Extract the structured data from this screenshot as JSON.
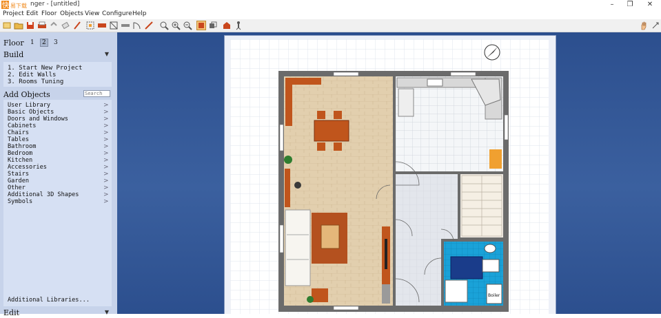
{
  "window": {
    "logo_text": "快",
    "logo_sub": "易下载",
    "title": "nger - [untitled]",
    "minimize_glyph": "–",
    "maximize_glyph": "❐",
    "close_glyph": "✕"
  },
  "menu": [
    "Project",
    "Edit",
    "Floor",
    "Objects",
    "View",
    "Configure",
    "Help"
  ],
  "toolbar_icons": [
    "new-project-icon",
    "open-icon",
    "save-icon",
    "print-icon",
    "undo-icon",
    "eraser-icon",
    "paint-icon",
    "select-icon",
    "wall-icon",
    "rubber-icon",
    "measure-icon",
    "door-icon",
    "rotate-icon",
    "texture-icon",
    "zoom-fit-icon",
    "zoom-in-icon",
    "zoom-out-icon",
    "view-2d-icon",
    "view-3d-icon",
    "camera-icon",
    "walk-icon",
    "hand-icon",
    "resize-icon"
  ],
  "left": {
    "floor_label": "Floor",
    "floors": [
      "1",
      "2",
      "3"
    ],
    "build_title": "Build",
    "build_steps": [
      "1. Start New Project",
      "2. Edit Walls",
      "3. Rooms Tuning"
    ],
    "add_objects_title": "Add Objects",
    "search_placeholder": "Search",
    "categories": [
      "User Library",
      "Basic Objects",
      "Doors and Windows",
      "Cabinets",
      "Chairs",
      "Tables",
      "Bathroom",
      "Bedroom",
      "Kitchen",
      "Accessories",
      "Stairs",
      "Garden",
      "Other",
      "Additional 3D Shapes",
      "Symbols"
    ],
    "additional_libraries": "Additional Libraries...",
    "edit_title": "Edit",
    "chevron": ">",
    "collapse_arrow": "▼"
  },
  "plan": {
    "boiler_label": "Boiler"
  },
  "colors": {
    "panel_bg": "#c7d3ea",
    "canvas_bg": "#2c4f8e",
    "wall": "#6b6b6b",
    "wood_floor": "#e6d3b3",
    "furniture_orange": "#c0551c",
    "bath_tile": "#1aa2d8"
  }
}
